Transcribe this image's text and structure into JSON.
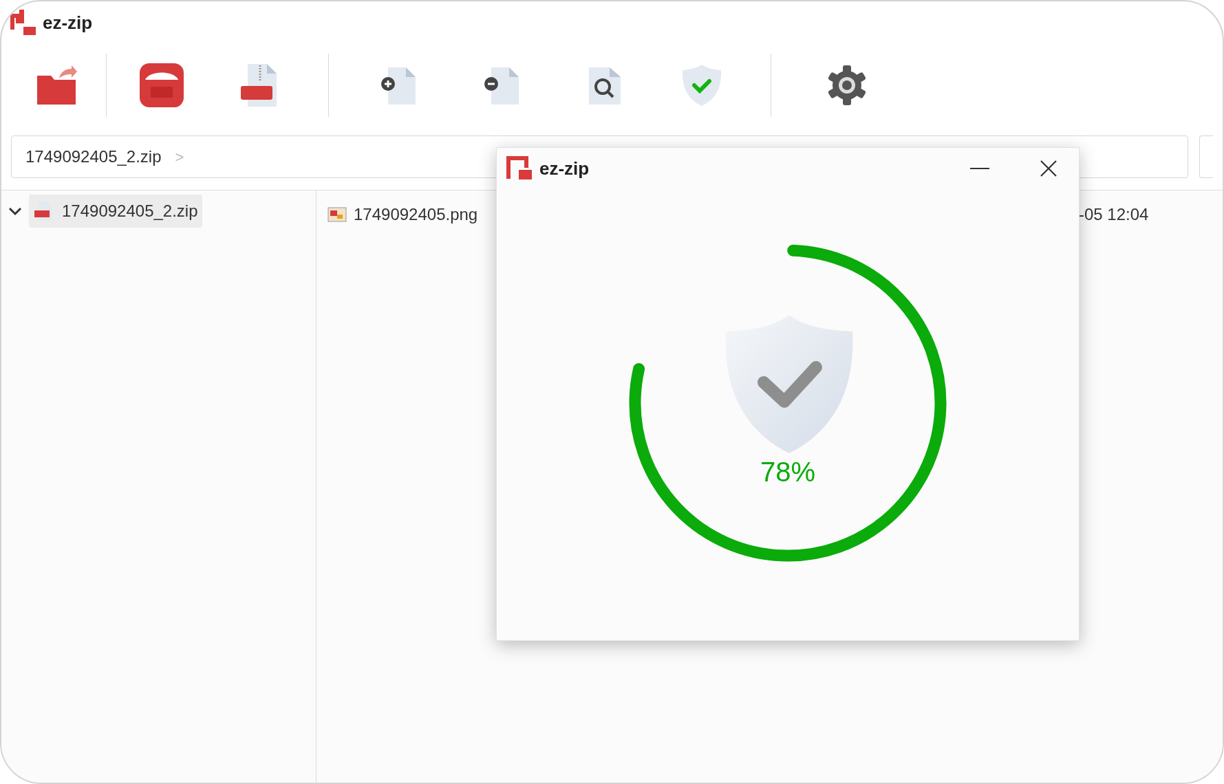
{
  "window": {
    "title": "ez-zip"
  },
  "toolbar": [
    {
      "kind": "open-folder"
    },
    {
      "kind": "zip"
    },
    {
      "kind": "zip-file"
    },
    {
      "kind": "sep"
    },
    {
      "kind": "add-file"
    },
    {
      "kind": "remove-file"
    },
    {
      "kind": "find-file"
    },
    {
      "kind": "verify"
    },
    {
      "kind": "sep2"
    },
    {
      "kind": "settings"
    }
  ],
  "path_bar": {
    "segments": [
      "1749092405_2.zip"
    ],
    "separator": ">"
  },
  "tree": [
    {
      "label": "1749092405_2.zip",
      "expanded": true,
      "selected": true
    }
  ],
  "files": [
    {
      "name": "1749092405.png",
      "modified": "-05 12:04"
    }
  ],
  "dialog": {
    "title": "ez-zip",
    "progress": {
      "level": 0.78,
      "reading": "78%"
    }
  }
}
